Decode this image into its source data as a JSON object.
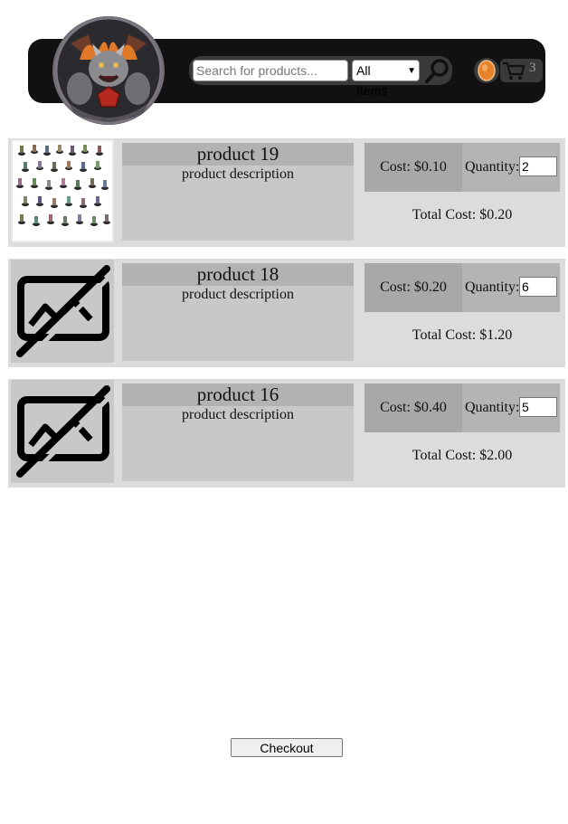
{
  "header": {
    "search_placeholder": "Search for products...",
    "category_selected": "All Items",
    "cart_count": "3",
    "logo_icon": "dragon-emblem-logo",
    "search_icon": "magnifier-icon",
    "coin_icon": "coin-icon",
    "cart_icon": "shopping-cart-icon"
  },
  "products": [
    {
      "name": "product 19",
      "description": "product description",
      "cost": "Cost: $0.10",
      "quantity_label": "Quantity:",
      "quantity": "2",
      "total": "Total Cost: $0.20",
      "image": "miniatures-photo"
    },
    {
      "name": "product 18",
      "description": "product description",
      "cost": "Cost: $0.20",
      "quantity_label": "Quantity:",
      "quantity": "6",
      "total": "Total Cost: $1.20",
      "image": "no-image-icon"
    },
    {
      "name": "product 16",
      "description": "product description",
      "cost": "Cost: $0.40",
      "quantity_label": "Quantity:",
      "quantity": "5",
      "total": "Total Cost: $2.00",
      "image": "no-image-icon"
    }
  ],
  "checkout_label": "Checkout",
  "colors": {
    "header_bg": "#111111",
    "row_bg": "#dcdcdc",
    "cost_bg": "#a8a8a8",
    "qty_bg": "#b4b4b4",
    "coin": "#e8822a"
  }
}
